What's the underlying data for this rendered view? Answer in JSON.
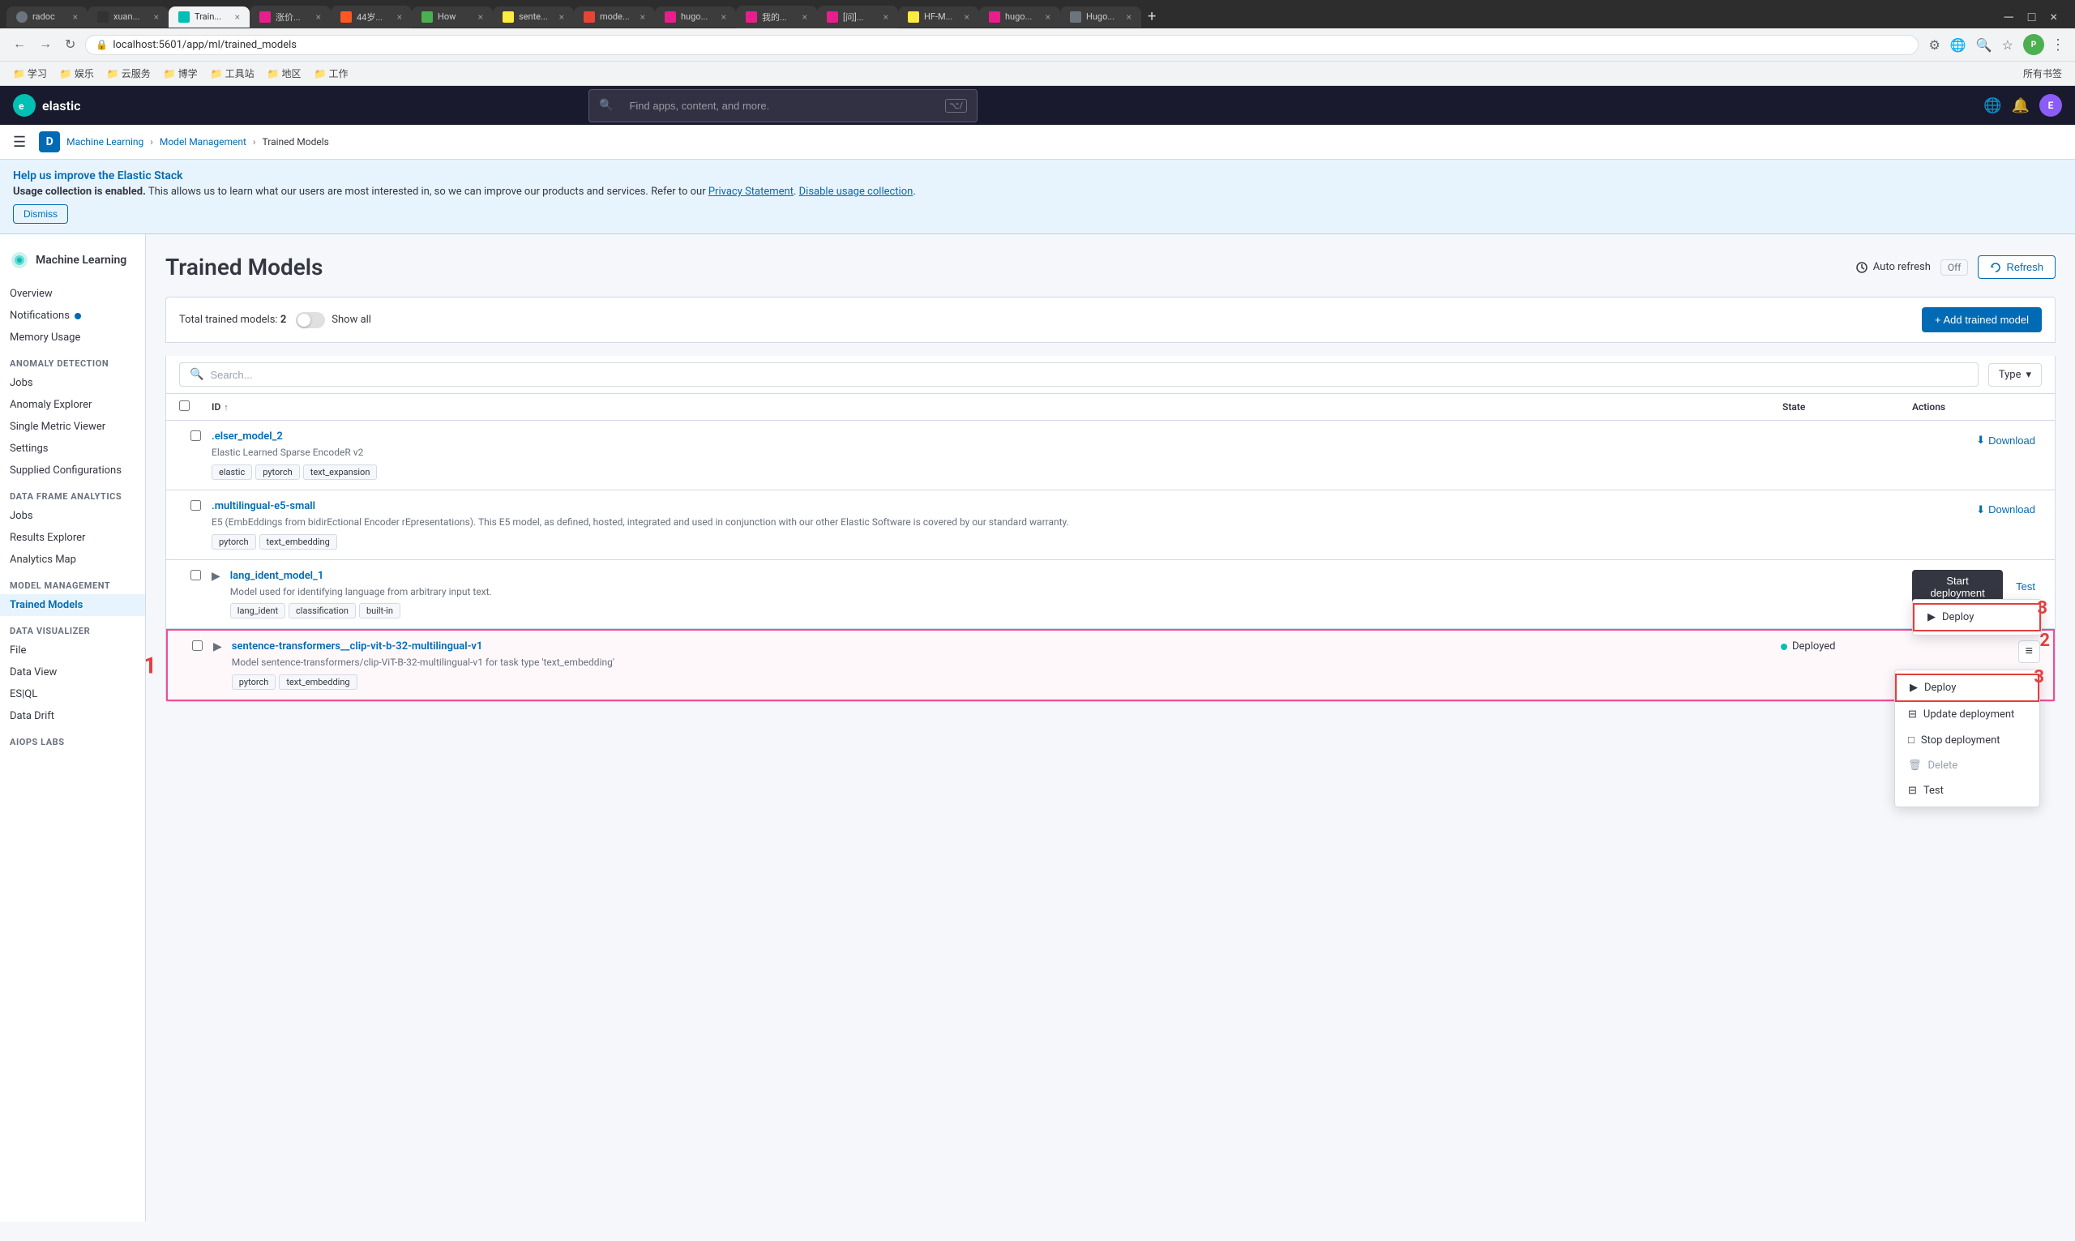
{
  "browser": {
    "address": "localhost:5601/app/ml/trained_models",
    "tabs": [
      {
        "id": "tab-radoc",
        "label": "radoc",
        "favicon_color": "#6c757d",
        "active": false
      },
      {
        "id": "tab-xuan",
        "label": "xuan...",
        "favicon_color": "#333",
        "active": false
      },
      {
        "id": "tab-train",
        "label": "Train...",
        "favicon_color": "#00bfb3",
        "active": true
      },
      {
        "id": "tab-jiage",
        "label": "涨价...",
        "favicon_color": "#e91e8c",
        "active": false
      },
      {
        "id": "tab-44sui",
        "label": "44岁...",
        "favicon_color": "#ff5722",
        "active": false
      },
      {
        "id": "tab-how",
        "label": "How",
        "favicon_color": "#4caf50",
        "active": false
      },
      {
        "id": "tab-sente",
        "label": "sente...",
        "favicon_color": "#ffeb3b",
        "active": false
      },
      {
        "id": "tab-mode",
        "label": "mode...",
        "favicon_color": "#ea4335",
        "active": false
      },
      {
        "id": "tab-hugo1",
        "label": "hugo...",
        "favicon_color": "#e91e8c",
        "active": false
      },
      {
        "id": "tab-mydi",
        "label": "我的...",
        "favicon_color": "#e91e8c",
        "active": false
      },
      {
        "id": "tab-wenti",
        "label": "[问]...",
        "favicon_color": "#e91e8c",
        "active": false
      },
      {
        "id": "tab-hfm",
        "label": "HF-M...",
        "favicon_color": "#ffeb3b",
        "active": false
      },
      {
        "id": "tab-hugo2",
        "label": "hugo...",
        "favicon_color": "#e91e8c",
        "active": false
      },
      {
        "id": "tab-Hugo3",
        "label": "Hugo...",
        "favicon_color": "#6c757d",
        "active": false
      }
    ],
    "bookmarks": [
      "学习",
      "娱乐",
      "云服务",
      "博学",
      "工具站",
      "地区",
      "工作"
    ],
    "all_bookmarks_label": "所有书签"
  },
  "elastic": {
    "logo_text": "elastic",
    "search_placeholder": "Find apps, content, and more.",
    "search_shortcut": "⌥/"
  },
  "breadcrumb": {
    "items": [
      "Machine Learning",
      "Model Management",
      "Trained Models"
    ]
  },
  "banner": {
    "title": "Help us improve the Elastic Stack",
    "usage_label": "Usage collection is enabled.",
    "usage_text": " This allows us to learn what our users are most interested in, so we can improve our products and services. Refer to our ",
    "privacy_link": "Privacy Statement",
    "disable_link": "Disable usage collection",
    "dismiss_label": "Dismiss"
  },
  "sidebar": {
    "title": "Machine Learning",
    "sections": [
      {
        "label": "",
        "items": [
          {
            "id": "overview",
            "label": "Overview",
            "active": false
          },
          {
            "id": "notifications",
            "label": "Notifications",
            "active": false,
            "dot": true
          },
          {
            "id": "memory-usage",
            "label": "Memory Usage",
            "active": false
          }
        ]
      },
      {
        "label": "Anomaly Detection",
        "items": [
          {
            "id": "jobs-ad",
            "label": "Jobs",
            "active": false
          },
          {
            "id": "anomaly-explorer",
            "label": "Anomaly Explorer",
            "active": false
          },
          {
            "id": "single-metric",
            "label": "Single Metric Viewer",
            "active": false
          },
          {
            "id": "settings",
            "label": "Settings",
            "active": false
          },
          {
            "id": "supplied-configs",
            "label": "Supplied Configurations",
            "active": false
          }
        ]
      },
      {
        "label": "Data Frame Analytics",
        "items": [
          {
            "id": "jobs-dfa",
            "label": "Jobs",
            "active": false
          },
          {
            "id": "results-explorer",
            "label": "Results Explorer",
            "active": false
          },
          {
            "id": "analytics-map",
            "label": "Analytics Map",
            "active": false
          }
        ]
      },
      {
        "label": "Model Management",
        "items": [
          {
            "id": "trained-models",
            "label": "Trained Models",
            "active": true
          }
        ]
      },
      {
        "label": "Data Visualizer",
        "items": [
          {
            "id": "file",
            "label": "File",
            "active": false
          },
          {
            "id": "data-view",
            "label": "Data View",
            "active": false
          },
          {
            "id": "esql",
            "label": "ES|QL",
            "active": false
          },
          {
            "id": "data-drift",
            "label": "Data Drift",
            "active": false
          }
        ]
      },
      {
        "label": "AIOps Labs",
        "items": []
      }
    ]
  },
  "page": {
    "title": "Trained Models",
    "auto_refresh_label": "Auto refresh",
    "off_label": "Off",
    "refresh_label": "Refresh",
    "add_model_label": "+ Add trained model",
    "total_label": "Total trained models:",
    "total_count": "2",
    "show_all_label": "Show all",
    "search_placeholder": "Search...",
    "type_label": "Type",
    "table_headers": {
      "id": "ID",
      "state": "State",
      "actions": "Actions"
    },
    "models": [
      {
        "id": ".elser_model_2",
        "description": "Elastic Learned Sparse EncodeR v2",
        "tags": [
          "elastic",
          "pytorch",
          "text_expansion"
        ],
        "state": "",
        "actions": "Download",
        "has_expand": false
      },
      {
        "id": ".multilingual-e5-small",
        "description": "E5 (EmbEddings from bidirEctional Encoder rEpresentations). This E5 model, as defined, hosted, integrated and used in conjunction with our other Elastic Software is covered by our standard warranty.",
        "tags": [
          "pytorch",
          "text_embedding"
        ],
        "state": "",
        "actions": "Download",
        "has_expand": false
      },
      {
        "id": "lang_ident_model_1",
        "description": "Model used for identifying language from arbitrary input text.",
        "tags": [
          "lang_ident",
          "classification",
          "built-in"
        ],
        "state": "",
        "actions": "start_deployment",
        "start_deploy_label": "Start deployment",
        "deploy_label": "Deploy",
        "test_label": "Test",
        "has_expand": true,
        "show_context_menu": false
      },
      {
        "id": "sentence-transformers__clip-vit-b-32-multilingual-v1",
        "description": "Model sentence-transformers/clip-ViT-B-32-multilingual-v1 for task type 'text_embedding'",
        "tags": [
          "pytorch",
          "text_embedding"
        ],
        "state": "Deployed",
        "state_color": "#00bfb3",
        "has_expand": true,
        "selected": true,
        "show_context_menu": true,
        "annotation_num": "1"
      }
    ],
    "context_menu": {
      "deploy_item": "Deploy",
      "deploy_annotation": "3",
      "update_deployment": "Update deployment",
      "stop_deployment": "Stop deployment",
      "delete": "Delete",
      "test": "Test",
      "more_btn_annotation": "2"
    }
  }
}
